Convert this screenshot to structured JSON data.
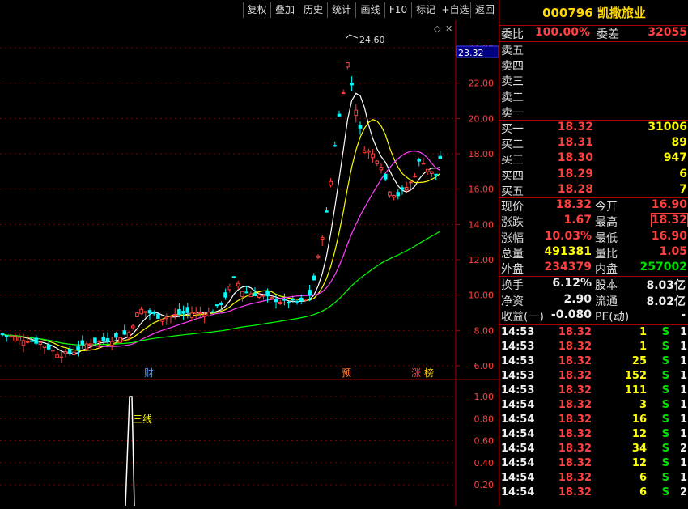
{
  "toolbar": [
    "复权",
    "叠加",
    "历史",
    "统计",
    "画线",
    "F10",
    "标记",
    "+自选",
    "返回"
  ],
  "price_chart": {
    "high_label": "24.60",
    "current_price_tag": "23.32",
    "axis_ticks": [
      "24.00",
      "22.00",
      "20.00",
      "18.00",
      "16.00",
      "14.00",
      "12.00",
      "10.00",
      "8.00",
      "6.00"
    ],
    "markers": [
      "财",
      "预",
      "涨",
      "榜"
    ]
  },
  "indicator_chart": {
    "line_label": "三线",
    "axis_ticks": [
      "1.00",
      "0.80",
      "0.60",
      "0.40",
      "0.20"
    ]
  },
  "stock": {
    "code": "000796",
    "name": "凯撒旅业"
  },
  "ratio": {
    "label1": "委比",
    "value1": "100.00%",
    "label2": "委差",
    "value2": "32055"
  },
  "asks": [
    {
      "label": "卖五"
    },
    {
      "label": "卖四"
    },
    {
      "label": "卖三"
    },
    {
      "label": "卖二"
    },
    {
      "label": "卖一"
    }
  ],
  "bids": [
    {
      "label": "买一",
      "price": "18.32",
      "volume": "31006"
    },
    {
      "label": "买二",
      "price": "18.31",
      "volume": "89"
    },
    {
      "label": "买三",
      "price": "18.30",
      "volume": "947"
    },
    {
      "label": "买四",
      "price": "18.29",
      "volume": "6"
    },
    {
      "label": "买五",
      "price": "18.28",
      "volume": "7"
    }
  ],
  "quote": [
    {
      "l1": "现价",
      "v1": "18.32",
      "l2": "今开",
      "v2": "16.90"
    },
    {
      "l1": "涨跌",
      "v1": "1.67",
      "l2": "最高",
      "v2": "18.32"
    },
    {
      "l1": "涨幅",
      "v1": "10.03%",
      "l2": "最低",
      "v2": "16.90"
    },
    {
      "l1": "总量",
      "v1": "491381",
      "l2": "量比",
      "v2": "1.05"
    },
    {
      "l1": "外盘",
      "v1": "234379",
      "l2": "内盘",
      "v2": "257002"
    }
  ],
  "fundamentals": [
    {
      "l1": "换手",
      "v1": "6.12%",
      "l2": "股本",
      "v2": "8.03亿"
    },
    {
      "l1": "净资",
      "v1": "2.90",
      "l2": "流通",
      "v2": "8.02亿"
    },
    {
      "l1": "收益(一)",
      "v1": "-0.080",
      "l2": "PE(动)",
      "v2": "-"
    }
  ],
  "ticks": [
    {
      "time": "14:53",
      "price": "18.32",
      "vol": "1",
      "side": "S",
      "n": "1"
    },
    {
      "time": "14:53",
      "price": "18.32",
      "vol": "1",
      "side": "S",
      "n": "1"
    },
    {
      "time": "14:53",
      "price": "18.32",
      "vol": "25",
      "side": "S",
      "n": "1"
    },
    {
      "time": "14:53",
      "price": "18.32",
      "vol": "152",
      "side": "S",
      "n": "1"
    },
    {
      "time": "14:53",
      "price": "18.32",
      "vol": "111",
      "side": "S",
      "n": "1"
    },
    {
      "time": "14:54",
      "price": "18.32",
      "vol": "3",
      "side": "S",
      "n": "1"
    },
    {
      "time": "14:54",
      "price": "18.32",
      "vol": "16",
      "side": "S",
      "n": "1"
    },
    {
      "time": "14:54",
      "price": "18.32",
      "vol": "12",
      "side": "S",
      "n": "1"
    },
    {
      "time": "14:54",
      "price": "18.32",
      "vol": "34",
      "side": "S",
      "n": "2"
    },
    {
      "time": "14:54",
      "price": "18.32",
      "vol": "12",
      "side": "S",
      "n": "1"
    },
    {
      "time": "14:54",
      "price": "18.32",
      "vol": "6",
      "side": "S",
      "n": "1"
    },
    {
      "time": "14:54",
      "price": "18.32",
      "vol": "6",
      "side": "S",
      "n": "2"
    }
  ],
  "colors": {
    "up": "#ff4040",
    "down": "#00ffff",
    "frame": "#aa0000"
  }
}
